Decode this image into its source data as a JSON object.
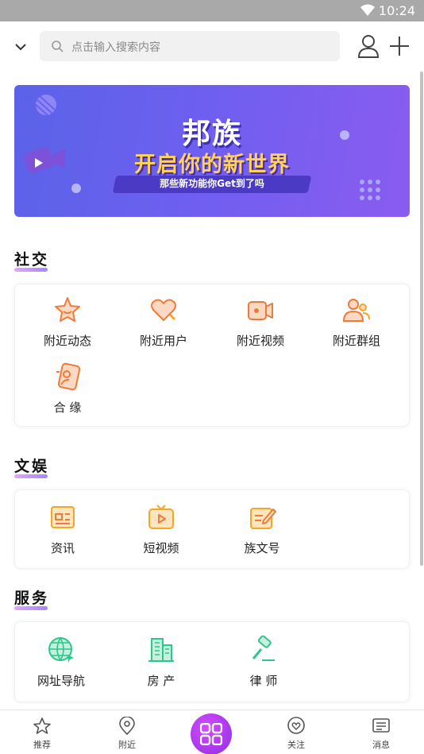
{
  "status_bar": {
    "time": "10:24"
  },
  "search": {
    "placeholder": "点击输入搜索内容"
  },
  "banner": {
    "title": "邦族",
    "subtitle": "开启你的新世界",
    "tagline": "那些新功能你Get到了吗"
  },
  "sections": {
    "social": {
      "title": "社交",
      "items": [
        {
          "label": "附近动态",
          "icon": "star-face-icon",
          "color": "#f07a3a"
        },
        {
          "label": "附近用户",
          "icon": "heart-icon",
          "color": "#f07a3a"
        },
        {
          "label": "附近视频",
          "icon": "video-camera-icon",
          "color": "#f07a3a"
        },
        {
          "label": "附近群组",
          "icon": "group-icon",
          "color": "#f07a3a"
        },
        {
          "label": "合 缘",
          "icon": "couple-icon",
          "color": "#f07a3a"
        }
      ]
    },
    "media": {
      "title": "文娱",
      "items": [
        {
          "label": "资讯",
          "icon": "news-icon",
          "color": "#f5a623"
        },
        {
          "label": "短视频",
          "icon": "tv-play-icon",
          "color": "#f5a623"
        },
        {
          "label": "族文号",
          "icon": "edit-note-icon",
          "color": "#f5a623"
        }
      ]
    },
    "services": {
      "title": "服务",
      "items": [
        {
          "label": "网址导航",
          "icon": "globe-icon",
          "color": "#2ec68a"
        },
        {
          "label": "房 产",
          "icon": "building-icon",
          "color": "#2ec68a"
        },
        {
          "label": "律 师",
          "icon": "gavel-icon",
          "color": "#2ec68a"
        }
      ]
    }
  },
  "bottom_nav": {
    "items": [
      {
        "label": "推荐",
        "icon": "star-outline-icon"
      },
      {
        "label": "附近",
        "icon": "location-pin-icon"
      },
      {
        "label": "",
        "icon": "grid-apps-icon"
      },
      {
        "label": "关注",
        "icon": "heart-pin-icon"
      },
      {
        "label": "消息",
        "icon": "message-icon"
      }
    ]
  },
  "colors": {
    "accent": "#a53bf0",
    "banner": "#6d5ff0",
    "social": "#f07a3a",
    "media": "#f5a623",
    "services": "#2ec68a"
  }
}
